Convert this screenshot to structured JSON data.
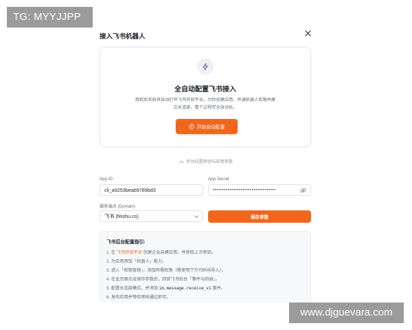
{
  "watermarks": {
    "top_left": "TG: MYYJJPP",
    "bottom_right": "www.djguevara.com"
  },
  "dialog": {
    "title": "接入飞书机器人",
    "close_icon": "close-icon",
    "auto_card": {
      "icon": "lightning-icon",
      "title": "全自动配置飞书接入",
      "desc_line1": "授权后系统将自动打开飞书开放平台，为你创建应用、开通机器人权限并建",
      "desc_line2": "立长连接，整个过程完全自动化。",
      "button_label": "开始自动配置",
      "button_icon": "play-circle-icon"
    },
    "manual_toggle": {
      "icon": "chevron-up-icon",
      "label": "手动设置密钥与应用参数"
    },
    "form": {
      "app_id_label": "App ID",
      "app_id_value": "cli_a9253beab9789bd3",
      "app_secret_label": "App Secret",
      "app_secret_value": "••••••••••••••••••••••••••••••••••",
      "domain_label": "服务端点 (Domain)",
      "domain_value": "飞书 (feishu.cn)",
      "save_label": "保存参数"
    },
    "guide": {
      "title": "飞书后台配置指引:",
      "step1_pre": "1. 在 ",
      "step1_link": "飞书开放平台",
      "step1_post": " 创建企业自建应用，并获取上方密钥。",
      "step2": "2. 为应用添加「机器人」能力。",
      "step3": "3. 进入「权限管理」，添加所需权限（需使用下方代码块导入）。",
      "step4": "4. 在此页面点击保存参数后，回到飞书后台「事件与回调」。",
      "step5_pre": "5. 配置长连接模式，并添加 ",
      "step5_code": "im.message.receive_v1",
      "step5_post": " 事件。",
      "step6": "6. 发布应用并等待审核通过即可。"
    }
  }
}
